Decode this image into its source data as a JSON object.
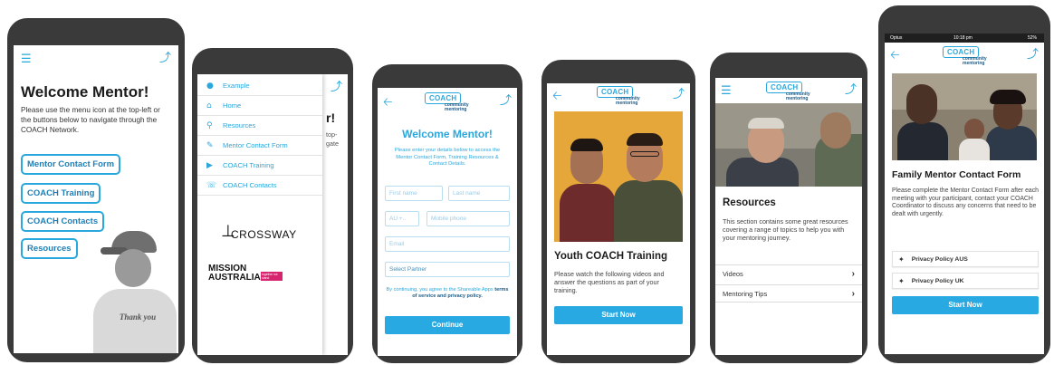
{
  "colors": {
    "accent": "#2aa7dc",
    "button": "#29a9e1",
    "frame": "#3a3a3a"
  },
  "brand": {
    "logo": "COACH",
    "logo_sub": "community mentoring"
  },
  "icons": {
    "menu": "hamburger-menu-icon",
    "share": "share-icon",
    "back": "back-arrow-icon"
  },
  "screen1": {
    "title": "Welcome Mentor!",
    "intro": "Please use the menu icon at the top-left or the buttons below to navigate through the COACH Network.",
    "buttons": [
      "Mentor Contact Form",
      "COACH Training",
      "COACH Contacts",
      "Resources"
    ],
    "shirt_text": "Thank you"
  },
  "screen2": {
    "menu": [
      {
        "icon": "user-icon",
        "label": "Example"
      },
      {
        "icon": "home-icon",
        "label": "Home"
      },
      {
        "icon": "lightbulb-icon",
        "label": "Resources"
      },
      {
        "icon": "edit-icon",
        "label": "Mentor Contact Form"
      },
      {
        "icon": "play-icon",
        "label": "COACH Training"
      },
      {
        "icon": "phone-icon",
        "label": "COACH Contacts"
      }
    ],
    "behind_title": "r!",
    "behind_text_1": "top-",
    "behind_text_2": "gate",
    "sponsor_1": "CROSSWAY",
    "sponsor_2_line1": "MISSION",
    "sponsor_2_line2": "AUSTRALIA",
    "sponsor_2_tag": "together we stand"
  },
  "screen3": {
    "title": "Welcome Mentor!",
    "intro": "Please enter your details below to access the Mentor Contact Form, Training Resources & Contact Details.",
    "first_name": "First name",
    "last_name": "Last name",
    "country": "AU +..",
    "mobile": "Mobile phone",
    "email": "Email",
    "partner": "Select Partner",
    "terms_pre": "By continuing, you agree to the Shareable Apps",
    "terms_link": "terms of service and privacy policy.",
    "continue": "Continue"
  },
  "screen4": {
    "title": "Youth COACH Training",
    "text": "Please watch the following videos and answer the questions as part of your training.",
    "button": "Start Now"
  },
  "screen5": {
    "title": "Resources",
    "text": "This section contains some great resources covering a range of topics to help you with your mentoring journey.",
    "items": [
      "Videos",
      "Mentoring Tips"
    ]
  },
  "screen6": {
    "status_carrier": "Optus",
    "status_time": "10:18 pm",
    "status_battery": "52%",
    "title": "Family Mentor Contact Form",
    "text": "Please complete the Mentor Contact Form after each meeting with your participant, contact your COACH Coordinator to discuss any concerns that need to be dealt with urgently.",
    "policies": [
      "Privacy Policy AUS",
      "Privacy Policy UK"
    ],
    "button": "Start Now"
  }
}
